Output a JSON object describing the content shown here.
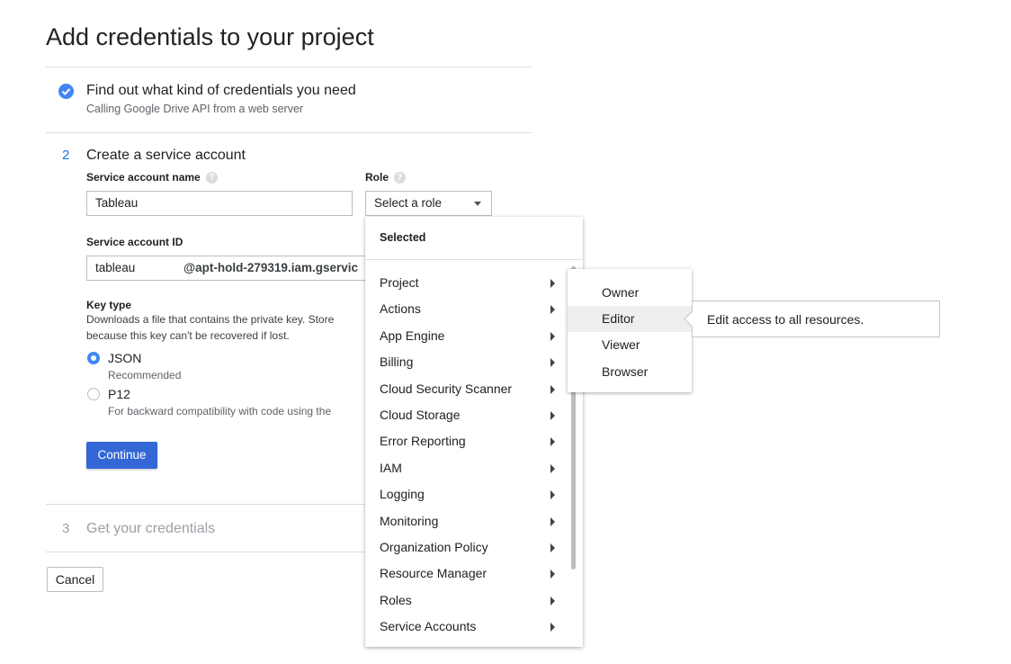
{
  "page_title": "Add credentials to your project",
  "step1": {
    "title": "Find out what kind of credentials you need",
    "subtitle": "Calling Google Drive API from a web server"
  },
  "step2": {
    "number": "2",
    "title": "Create a service account",
    "service_account_name_label": "Service account name",
    "service_account_name_value": "Tableau",
    "role_label": "Role",
    "role_select_value": "Select a role",
    "service_account_id_label": "Service account ID",
    "service_account_id_value": "tableau",
    "service_account_domain": "@apt-hold-279319.iam.gservic",
    "key_type_label": "Key type",
    "key_type_desc_line1": "Downloads a file that contains the private key. Store",
    "key_type_desc_line2": "because this key can't be recovered if lost.",
    "json_label": "JSON",
    "json_sub": "Recommended",
    "p12_label": "P12",
    "p12_sub": "For backward compatibility with code using the",
    "continue_label": "Continue"
  },
  "step3": {
    "number": "3",
    "title": "Get your credentials"
  },
  "cancel_label": "Cancel",
  "role_menu": {
    "selected_header": "Selected",
    "items": [
      "Project",
      "Actions",
      "App Engine",
      "Billing",
      "Cloud Security Scanner",
      "Cloud Storage",
      "Error Reporting",
      "IAM",
      "Logging",
      "Monitoring",
      "Organization Policy",
      "Resource Manager",
      "Roles",
      "Service Accounts"
    ]
  },
  "project_submenu": {
    "items": [
      "Owner",
      "Editor",
      "Viewer",
      "Browser"
    ],
    "highlighted": "Editor"
  },
  "tooltip": "Edit access to all resources.",
  "colors": {
    "accent": "#1a73e8",
    "primary_button": "#3367d6",
    "check": "#4285f4"
  }
}
